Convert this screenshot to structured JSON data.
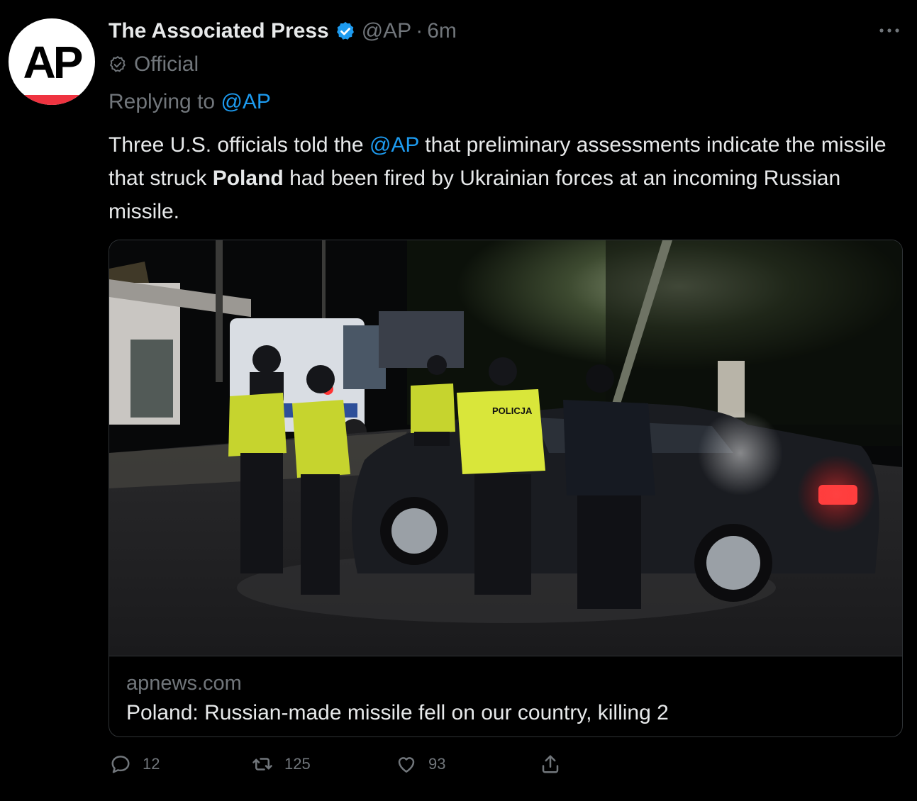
{
  "author": {
    "avatar_text": "AP",
    "name": "The Associated Press",
    "handle": "@AP",
    "separator": "·",
    "time": "6m",
    "badge": "Official",
    "verified_icon": "verified-badge-icon"
  },
  "reply": {
    "prefix": "Replying to",
    "handle": "@AP"
  },
  "tweet": {
    "part1": "Three U.S. officials told the ",
    "mention": "@AP",
    "part2": " that preliminary assessments indicate the missile that struck ",
    "bold": "Poland",
    "part3": " had been fired by Ukrainian forces at an incoming Russian missile."
  },
  "card": {
    "domain": "apnews.com",
    "title": "Poland: Russian-made missile fell on our country, killing 2",
    "image_vest_label": "POLICJA"
  },
  "actions": {
    "reply_count": "12",
    "retweet_count": "125",
    "like_count": "93"
  },
  "colors": {
    "accent": "#1d9bf0",
    "muted": "#71767b",
    "text": "#e7e9ea",
    "background": "#000000",
    "ap_red": "#ef3340"
  }
}
